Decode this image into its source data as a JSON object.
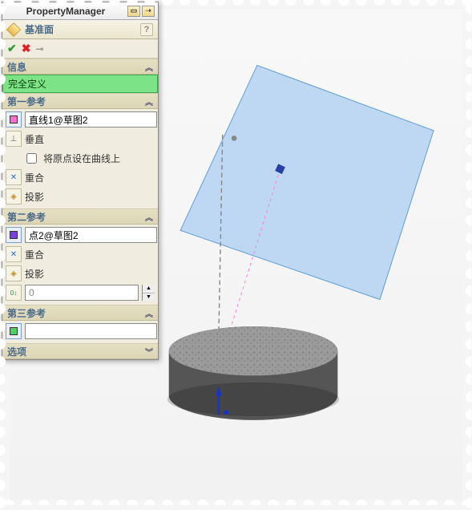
{
  "titlebar": {
    "text": "PropertyManager"
  },
  "feature": {
    "name": "基准面"
  },
  "sections": {
    "info": {
      "title": "信息",
      "status": "完全定义"
    },
    "ref1": {
      "title": "第一参考",
      "entity": "直线1@草图2",
      "perpendicular": "垂直",
      "origin_on_curve": "将原点设在曲线上",
      "coincident": "重合",
      "projection": "投影"
    },
    "ref2": {
      "title": "第二参考",
      "entity": "点2@草图2",
      "coincident": "重合",
      "projection": "投影",
      "offset_value": "0"
    },
    "ref3": {
      "title": "第三参考",
      "entity": ""
    },
    "options": {
      "title": "选项"
    }
  },
  "colors": {
    "ref1_swatch": "#ff6fcf",
    "ref2_swatch": "#7a3fe0",
    "ref3_swatch": "#4fd060"
  }
}
